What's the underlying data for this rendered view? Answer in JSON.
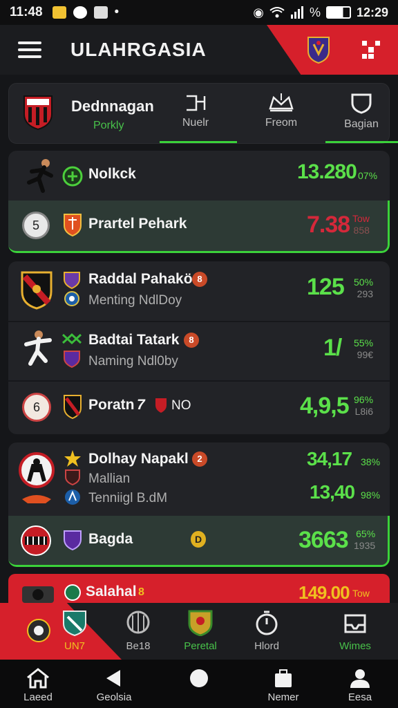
{
  "status_bar": {
    "time": "11:48",
    "battery_time": "12:29",
    "signal": "%"
  },
  "header": {
    "title": "ULAHRGASIA"
  },
  "top_card": {
    "team_name": "Dednnagan",
    "team_sub": "Porkly",
    "tabs": [
      {
        "label": "Nuelr",
        "icon": "bracket-icon"
      },
      {
        "label": "Freom",
        "icon": "crown-icon"
      },
      {
        "label": "Bagian",
        "icon": "shield-icon"
      }
    ]
  },
  "card1": {
    "rows": [
      {
        "name": "Nolkck",
        "score": "13.280",
        "pct_top": "07%"
      },
      {
        "rank": "5",
        "name": "Prartel Pehark",
        "score": "7.38",
        "pct_top": "Tow",
        "pct_bottom": "858"
      }
    ]
  },
  "card2": {
    "rows": [
      {
        "name": "Raddal Pahakö",
        "badge": "8",
        "sub": "Menting NdlDoy",
        "score": "125",
        "pct_top": "50%",
        "pct_bottom": "293"
      },
      {
        "name": "Badtai Tatark",
        "badge": "8",
        "sub": "Naming Ndl0by",
        "score": "1/",
        "pct_top": "55%",
        "pct_bottom": "99€"
      },
      {
        "rank": "6",
        "name": "Poratn",
        "extra": "7",
        "tag": "NO",
        "score": "4,9,5",
        "pct_top": "96%",
        "pct_bottom": "L8i6"
      }
    ]
  },
  "card3": {
    "rows": [
      {
        "name": "Dolhay Napakl",
        "badge": "2",
        "sub1": "Mallian",
        "sub2": "Tenniigl B.dM",
        "score1": "34,17",
        "pct1": "38%",
        "score2": "13,40",
        "pct2": "98%"
      },
      {
        "name": "Bagda",
        "badge_mid": "D",
        "score": "3663",
        "pct_top": "65%",
        "pct_bottom": "1935"
      }
    ]
  },
  "red_strip": {
    "name": "Salahal",
    "badge": "8",
    "score": "149.00",
    "pct": "Tow"
  },
  "bottom_nav": [
    {
      "label": ""
    },
    {
      "label": "UN7"
    },
    {
      "label": "Be18"
    },
    {
      "label": "Peretal"
    },
    {
      "label": "Hlord"
    },
    {
      "label": "Wimes"
    }
  ],
  "system_nav": [
    {
      "label": "Laeed"
    },
    {
      "label": "Geolsia"
    },
    {
      "label": ""
    },
    {
      "label": "Nemer"
    },
    {
      "label": "Eesa"
    }
  ],
  "colors": {
    "accent_red": "#d6202b",
    "accent_green": "#3bd23a",
    "score_green": "#5be04a",
    "score_red": "#d4283a"
  }
}
